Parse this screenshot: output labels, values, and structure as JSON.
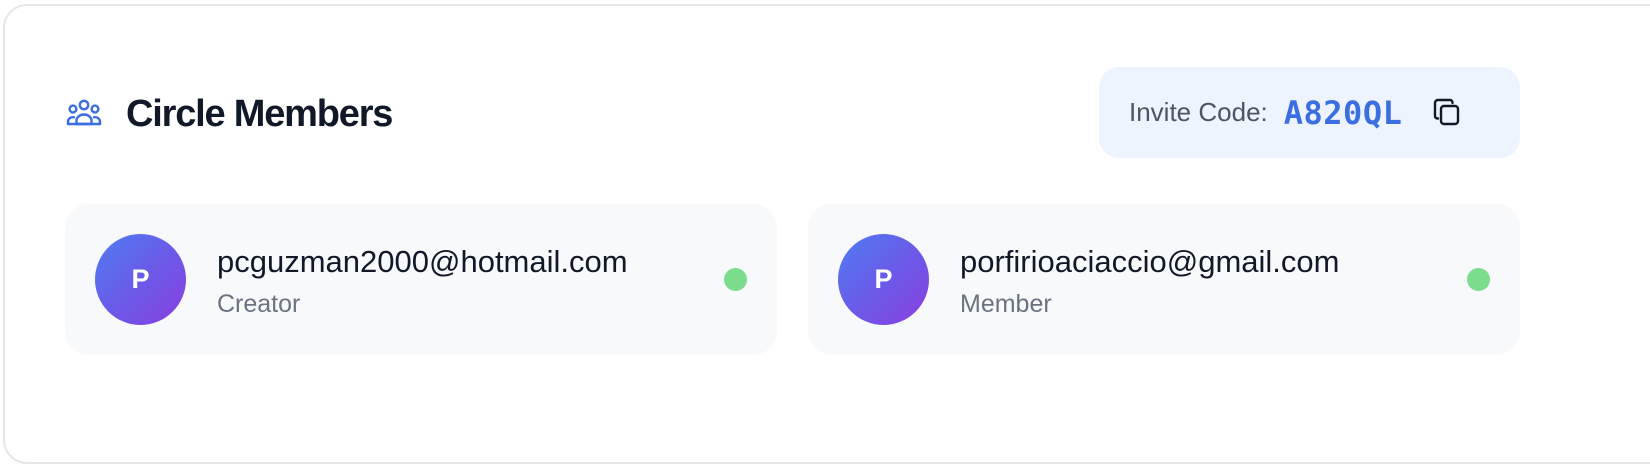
{
  "header": {
    "icon": "users-group-icon",
    "title": "Circle Members"
  },
  "invite": {
    "label": "Invite Code:",
    "code": "A820QL",
    "copy_icon": "copy-icon"
  },
  "members": [
    {
      "initial": "P",
      "email": "pcguzman2000@hotmail.com",
      "role": "Creator",
      "status": "online"
    },
    {
      "initial": "P",
      "email": "porfirioaciaccio@gmail.com",
      "role": "Member",
      "status": "online"
    }
  ],
  "colors": {
    "accent": "#3b6ee0",
    "online": "#7bdc8c",
    "avatar_gradient_start": "#4f7df0",
    "avatar_gradient_end": "#8a3ee0"
  }
}
